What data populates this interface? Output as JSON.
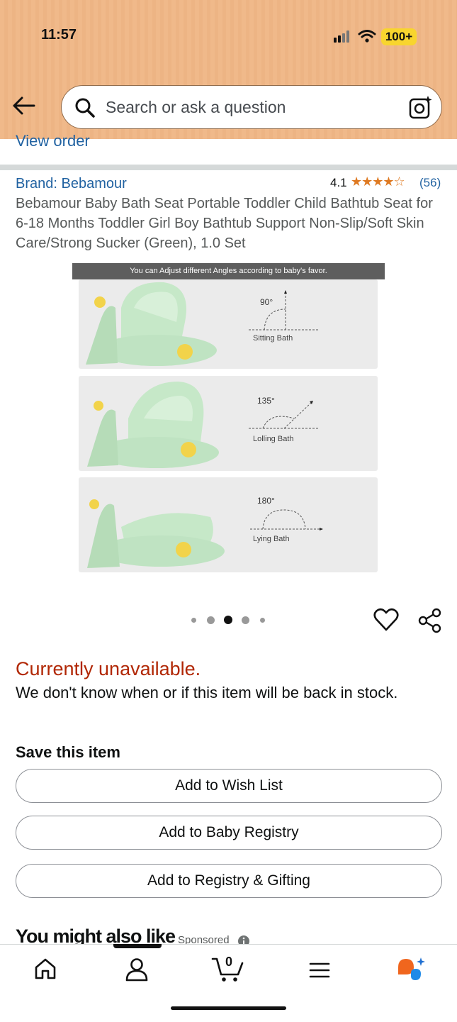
{
  "status_bar": {
    "time": "11:57",
    "battery": "100+"
  },
  "search": {
    "placeholder": "Search or ask a question"
  },
  "order": {
    "link": "View order"
  },
  "product": {
    "brand": "Brand: Bebamour",
    "rating": "4.1",
    "stars": "★★★★☆",
    "star_value": 4.1,
    "review_count": "(56)",
    "title": "Bebamour Baby Bath Seat Portable Toddler Child Bathtub Seat for 6-18 Months Toddler Girl Boy Bathtub Support Non-Slip/Soft Skin Care/Strong Sucker (Green), 1.0 Set"
  },
  "image": {
    "banner": "You can Adjust different Angles according to baby's favor.",
    "panels": [
      {
        "angle": "90°",
        "label": "Sitting Bath"
      },
      {
        "angle": "135°",
        "label": "Lolling Bath"
      },
      {
        "angle": "180°",
        "label": "Lying Bath"
      }
    ],
    "carousel": {
      "count": 5,
      "active_index": 2
    }
  },
  "availability": {
    "status": "Currently unavailable.",
    "message": "We don't know when or if this item will be back in stock."
  },
  "save": {
    "title": "Save this item",
    "buttons": [
      "Add to Wish List",
      "Add to Baby Registry",
      "Add to Registry & Gifting"
    ]
  },
  "recommend": {
    "title": "You might also like",
    "sponsored": "Sponsored"
  },
  "bottom_nav": {
    "cart_count": "0",
    "items": [
      "home-icon",
      "account-icon",
      "cart-icon",
      "menu-icon",
      "rufus-icon"
    ]
  },
  "colors": {
    "header": "#f0b98a",
    "link": "#2162a1",
    "unavailable": "#b12704",
    "star": "#de7921",
    "seat_green": "#bfe3c2"
  }
}
